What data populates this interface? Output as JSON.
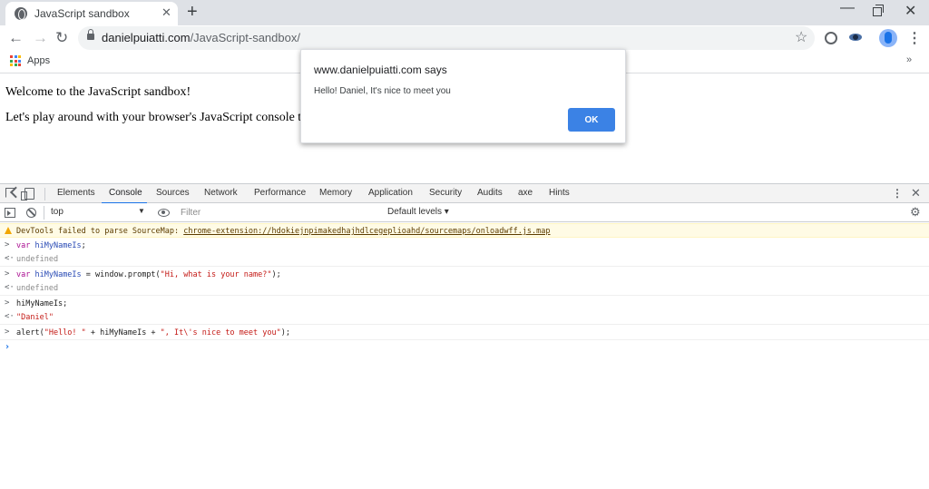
{
  "browser": {
    "tab_title": "JavaScript sandbox",
    "tab_close": "✕",
    "new_tab": "+",
    "window_controls": {
      "minimize": "—",
      "close": "✕"
    },
    "nav": {
      "back": "←",
      "forward": "→",
      "reload": "↻"
    },
    "url_host": "danielpuiatti.com",
    "url_path": "/JavaScript-sandbox/",
    "star": "☆",
    "menu": "⋮",
    "bookmarks": {
      "apps_label": "Apps",
      "more": "»"
    }
  },
  "page": {
    "heading": "Welcome to the JavaScript sandbox!",
    "paragraph": "Let's play around with your browser's JavaScript console to cha"
  },
  "dialog": {
    "title": "www.danielpuiatti.com says",
    "message": "Hello! Daniel, It's nice to meet you",
    "ok_label": "OK",
    "accent": "#3b82e5"
  },
  "devtools": {
    "tabs": [
      "Elements",
      "Console",
      "Sources",
      "Network",
      "Performance",
      "Memory",
      "Application",
      "Security",
      "Audits",
      "axe",
      "Hints"
    ],
    "active_tab": "Console",
    "kebab": "⋮",
    "close": "✕",
    "context": "top",
    "context_caret": "▼",
    "filter_placeholder": "Filter",
    "levels": "Default levels ▾",
    "settings": "⚙"
  },
  "console": {
    "warning_prefix": "DevTools failed to parse SourceMap: ",
    "warning_link": "chrome-extension://hdokiejnpimakedhajhdlcegeplioahd/sourcemaps/onloadwff.js.map",
    "input_prompt": ">",
    "output_prompt": "<·",
    "line1_kw": "var",
    "line1_var": "hiMyNameIs",
    "line1_end": ";",
    "result1": "undefined",
    "line2_kw": "var",
    "line2_var": "hiMyNameIs",
    "line2_mid": " = window.prompt(",
    "line2_str": "\"Hi, what is your name?\"",
    "line2_end": ");",
    "result2": "undefined",
    "line3": "hiMyNameIs;",
    "result3": "\"Daniel\"",
    "line4_start": "alert(",
    "line4_str1": "\"Hello! \"",
    "line4_mid": " + hiMyNameIs + ",
    "line4_str2": "\", It\\'s nice to meet you\"",
    "line4_end": ");",
    "caret": "›"
  }
}
